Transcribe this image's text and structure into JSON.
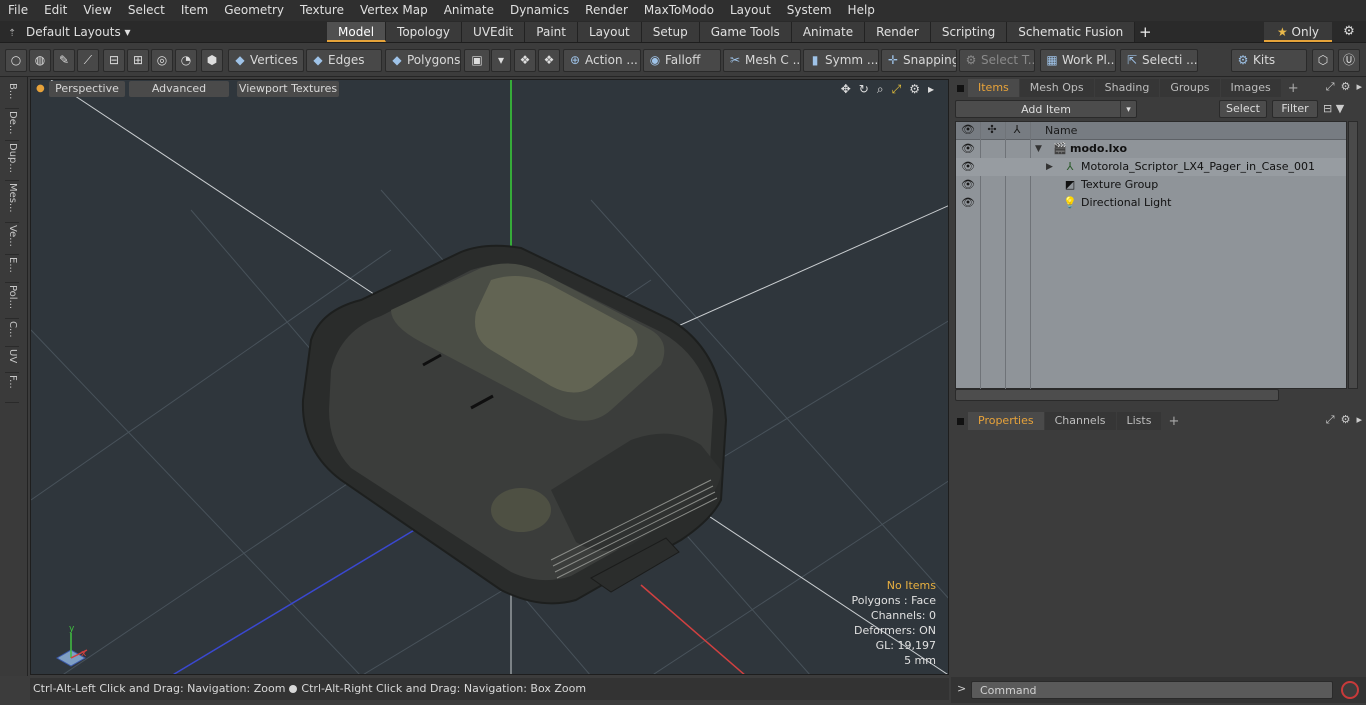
{
  "menu": [
    "File",
    "Edit",
    "View",
    "Select",
    "Item",
    "Geometry",
    "Texture",
    "Vertex Map",
    "Animate",
    "Dynamics",
    "Render",
    "MaxToModo",
    "Layout",
    "System",
    "Help"
  ],
  "layout": {
    "label": "Default Layouts ▾"
  },
  "tabs": [
    "Model",
    "Topology",
    "UVEdit",
    "Paint",
    "Layout",
    "Setup",
    "Game Tools",
    "Animate",
    "Render",
    "Scripting",
    "Schematic Fusion"
  ],
  "only_label": "Only",
  "toolbar": {
    "vertices": "Vertices",
    "edges": "Edges",
    "polygons": "Polygons",
    "action": "Action ...",
    "falloff": "Falloff",
    "meshc": "Mesh C ...",
    "symm": "Symm ...",
    "snapping": "Snapping",
    "select_t": "Select T...",
    "workpl": "Work Pl...",
    "selecti": "Selecti ...",
    "kits": "Kits"
  },
  "left_strip": [
    "B...",
    "De...",
    "Dup...",
    "Mes...",
    "Ve...",
    "E...",
    "Pol...",
    "C...",
    "UV",
    "F..."
  ],
  "viewport": {
    "perspective": "Perspective",
    "advanced": "Advanced",
    "textures": "Viewport Textures",
    "stats": {
      "items": "No Items",
      "polygons": "Polygons : Face",
      "channels": "Channels: 0",
      "deformers": "Deformers: ON",
      "gl": "GL: 19,197",
      "scale": "5 mm"
    }
  },
  "status": {
    "left": "Ctrl-Alt-Left Click and Drag: Navigation: Zoom",
    "right": "Ctrl-Alt-Right Click and Drag: Navigation: Box Zoom"
  },
  "items_panel": {
    "tabs": [
      "Items",
      "Mesh Ops",
      "Shading",
      "Groups",
      "Images"
    ],
    "add_item": "Add Item",
    "select": "Select",
    "filter": "Filter",
    "column_name": "Name",
    "rows": [
      {
        "label": "modo.lxo"
      },
      {
        "label": "Motorola_Scriptor_LX4_Pager_in_Case_001"
      },
      {
        "label": "Texture Group"
      },
      {
        "label": "Directional Light"
      }
    ]
  },
  "properties_panel": {
    "tabs": [
      "Properties",
      "Channels",
      "Lists"
    ]
  },
  "command": {
    "placeholder": "Command"
  }
}
